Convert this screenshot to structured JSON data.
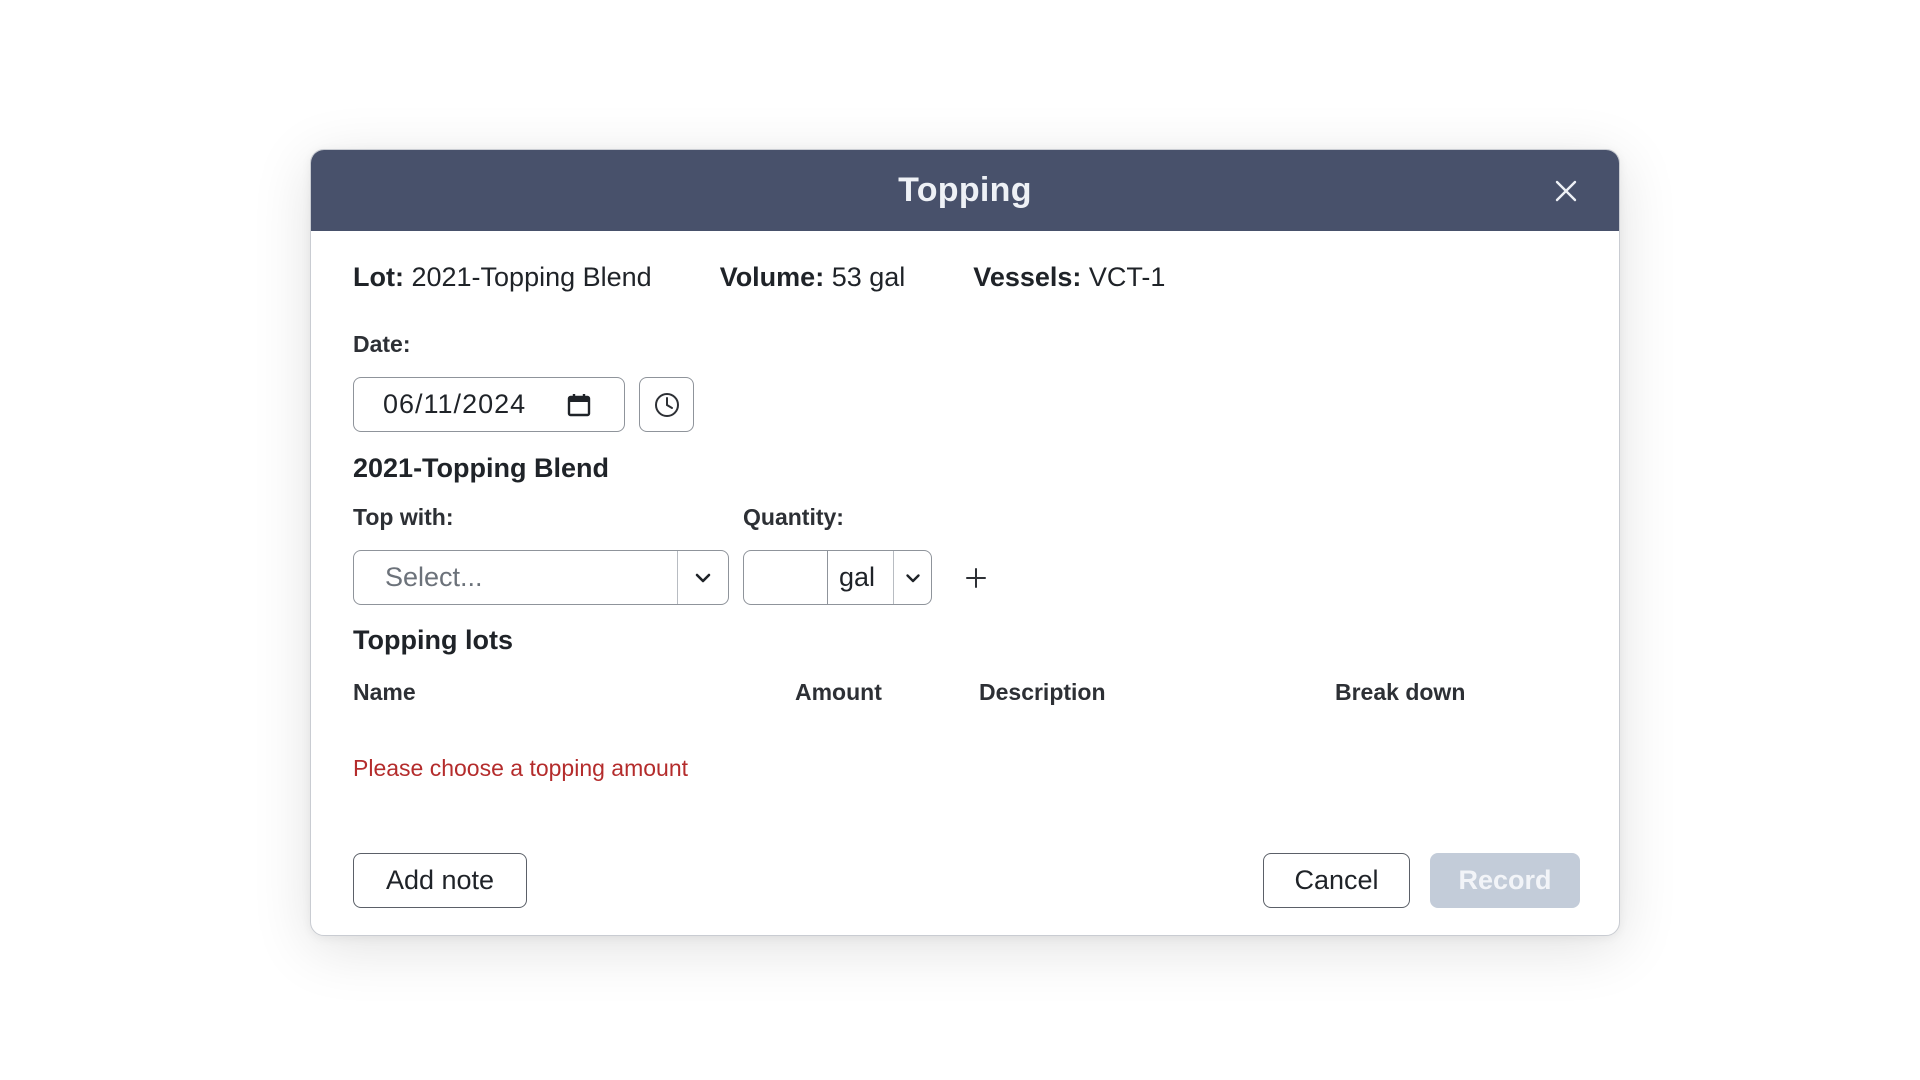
{
  "modal": {
    "title": "Topping"
  },
  "info": {
    "lot_label": "Lot:",
    "lot_value": "2021-Topping Blend",
    "volume_label": "Volume:",
    "volume_value": "53 gal",
    "vessels_label": "Vessels:",
    "vessels_value": "VCT-1"
  },
  "date": {
    "label": "Date:",
    "value": "06/11/2024"
  },
  "lot_section": {
    "title": "2021-Topping Blend",
    "top_with_label": "Top with:",
    "top_with_placeholder": "Select...",
    "quantity_label": "Quantity:",
    "quantity_value": "",
    "quantity_unit": "gal"
  },
  "topping_lots": {
    "title": "Topping lots",
    "columns": [
      "Name",
      "Amount",
      "Description",
      "Break down"
    ],
    "error": "Please choose a topping amount"
  },
  "footer": {
    "add_note_label": "Add note",
    "cancel_label": "Cancel",
    "record_label": "Record"
  },
  "colors": {
    "header_bg": "#48516b",
    "error": "#b42c2c",
    "disabled_button": "#c3ccd9"
  },
  "icons": {
    "close": "close-icon",
    "calendar": "calendar-icon",
    "clock": "clock-icon",
    "chevron": "chevron-down-icon",
    "plus": "plus-icon"
  }
}
